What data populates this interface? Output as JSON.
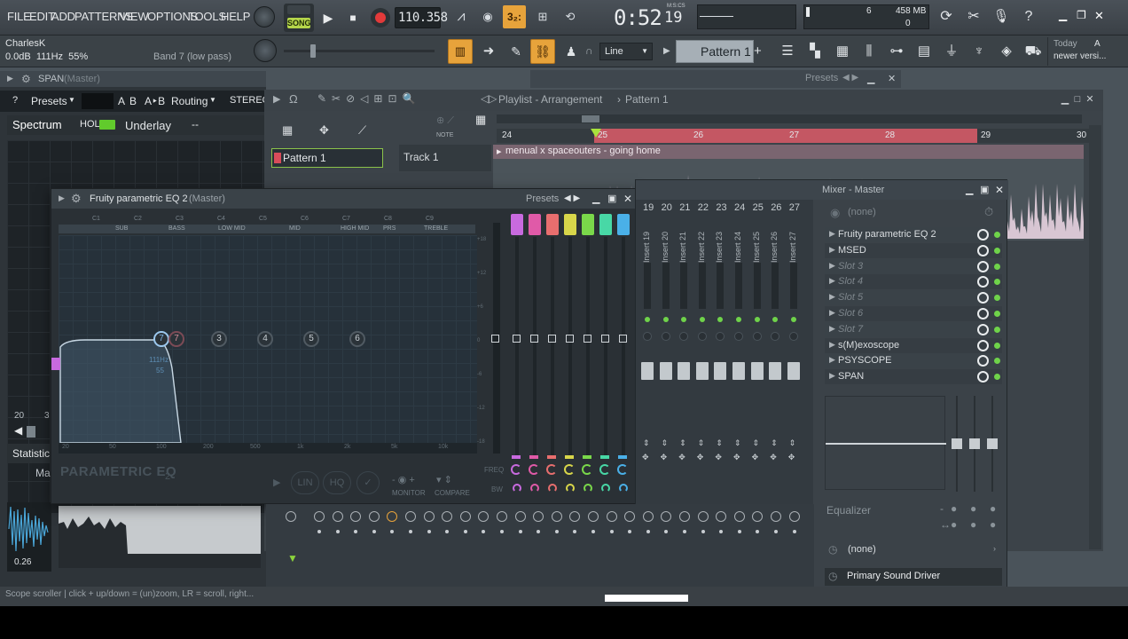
{
  "menu": [
    "FILE",
    "EDIT",
    "ADD",
    "PATTERNS",
    "VIEW",
    "OPTIONS",
    "TOOLS",
    "HELP"
  ],
  "transport": {
    "mode": "SONG",
    "tempo": "110.358",
    "time_main": "0:52",
    "time_sub": "19",
    "time_unit": "M:S:CS",
    "step_label": "3₂:",
    "cpu": "6",
    "memory": "458 MB",
    "polyphony": "0"
  },
  "hint": {
    "user": "CharlesK",
    "readout": "0.0dB  111Hz  55%",
    "param": "Band 7 (low pass)"
  },
  "toolbar": {
    "snap": "Line",
    "pattern": "Pattern 1",
    "news_title": "Today",
    "news_a": "A",
    "news_text": "newer versi..."
  },
  "span": {
    "title": "SPAN",
    "title_sub": "(Master)",
    "help": "?",
    "presets": "Presets",
    "a": "A",
    "b": "B",
    "ab": "A‣B",
    "routing": "Routing",
    "stereo": "STEREO",
    "spectrum": "Spectrum",
    "hold": "HOLD",
    "underlay": "Underlay",
    "underlay_val": "--",
    "axis1": "20",
    "axis2": "3",
    "statistics": "Statistic",
    "ma": "Ma",
    "scope_val": "0.26"
  },
  "playlist": {
    "title": "Playlist - Arrangement",
    "pattern": "Pattern 1",
    "presets": "Presets",
    "pattern_item": "Pattern 1",
    "track": "Track 1",
    "clip": "menual x spaceouters - going home",
    "bars": [
      "24",
      "25",
      "26",
      "27",
      "28",
      "29",
      "30"
    ],
    "note": "NOTE"
  },
  "eq": {
    "title": "Fruity parametric EQ 2",
    "title_sub": "(Master)",
    "presets": "Presets",
    "notes": [
      "C1",
      "C2",
      "C3",
      "C4",
      "C5",
      "C6",
      "C7",
      "C8",
      "C9"
    ],
    "bands": [
      "SUB",
      "BASS",
      "LOW MID",
      "MID",
      "HIGH MID",
      "PRS",
      "TREBLE"
    ],
    "nodes": [
      "7",
      "3",
      "4",
      "5",
      "6"
    ],
    "node_readout1": "111Hz",
    "node_readout2": "55",
    "db_ticks": [
      "+18",
      "+12",
      "+6",
      "0",
      "-6",
      "-12",
      "-18"
    ],
    "freq_ticks": [
      "20",
      "50",
      "100",
      "200",
      "500",
      "1k",
      "2k",
      "5k",
      "10k"
    ],
    "logo": "PARAMETRIC EQ",
    "logo_num": "2",
    "lin": "LIN",
    "hq": "HQ",
    "monitor": "MONITOR",
    "compare": "COMPARE",
    "freq_label": "FREQ",
    "bw_label": "BW",
    "band_colors": [
      "#c86adf",
      "#e05aa8",
      "#e86e6e",
      "#d8d64a",
      "#7ad84a",
      "#48d8a6",
      "#4ab0e8"
    ]
  },
  "mixer": {
    "title": "Mixer - Master",
    "channels": [
      "19",
      "20",
      "21",
      "22",
      "23",
      "24",
      "25",
      "26",
      "27"
    ],
    "channel_names": [
      "Insert 19",
      "Insert 20",
      "Insert 21",
      "Insert 22",
      "Insert 23",
      "Insert 24",
      "Insert 25",
      "Insert 26",
      "Insert 27"
    ],
    "preset_none": "(none)",
    "slots": [
      {
        "name": "Fruity parametric EQ 2",
        "empty": false
      },
      {
        "name": "MSED",
        "empty": false
      },
      {
        "name": "Slot 3",
        "empty": true
      },
      {
        "name": "Slot 4",
        "empty": true
      },
      {
        "name": "Slot 5",
        "empty": true
      },
      {
        "name": "Slot 6",
        "empty": true
      },
      {
        "name": "Slot 7",
        "empty": true
      },
      {
        "name": "s(M)exoscope",
        "empty": false
      },
      {
        "name": "PSYSCOPE",
        "empty": false
      },
      {
        "name": "SPAN",
        "empty": false
      }
    ],
    "equalizer": "Equalizer",
    "output_none": "(none)",
    "device": "Primary Sound Driver"
  },
  "status": "Scope scroller | click + up/down = (un)zoom, LR = scroll, right..."
}
